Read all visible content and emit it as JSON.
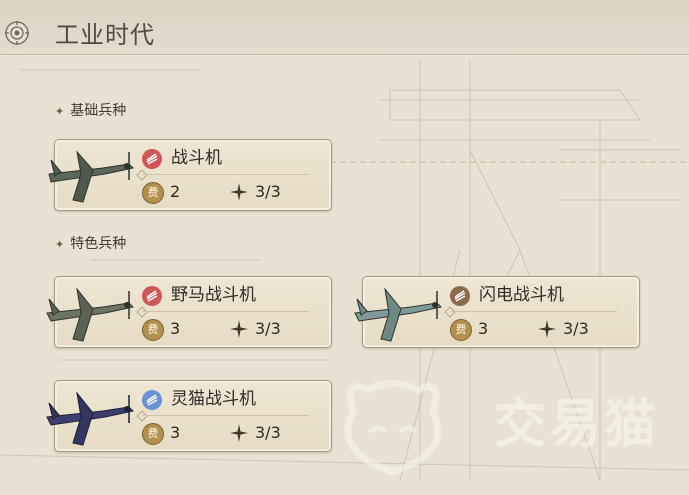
{
  "header": {
    "title": "工业时代",
    "logo_icon": "compass-gear-icon"
  },
  "sections": [
    {
      "label": "基础兵种",
      "star_icon": "star-icon"
    },
    {
      "label": "特色兵种",
      "star_icon": "star-icon"
    }
  ],
  "units": [
    {
      "name": "战斗机",
      "cost_icon_label": "费",
      "cost": "2",
      "count": "3/3",
      "badge_color": "#cf5757",
      "plane_color": "#5c6659"
    },
    {
      "name": "野马战斗机",
      "cost_icon_label": "费",
      "cost": "3",
      "count": "3/3",
      "badge_color": "#cf5757",
      "plane_color": "#6b7462"
    },
    {
      "name": "闪电战斗机",
      "cost_icon_label": "费",
      "cost": "3",
      "count": "3/3",
      "badge_color": "#8a6c4c",
      "plane_color": "#7f9a98"
    },
    {
      "name": "灵猫战斗机",
      "cost_icon_label": "费",
      "cost": "3",
      "count": "3/3",
      "badge_color": "#6b93d4",
      "plane_color": "#3c3f6e"
    }
  ],
  "watermark": {
    "text": "交易猫"
  }
}
